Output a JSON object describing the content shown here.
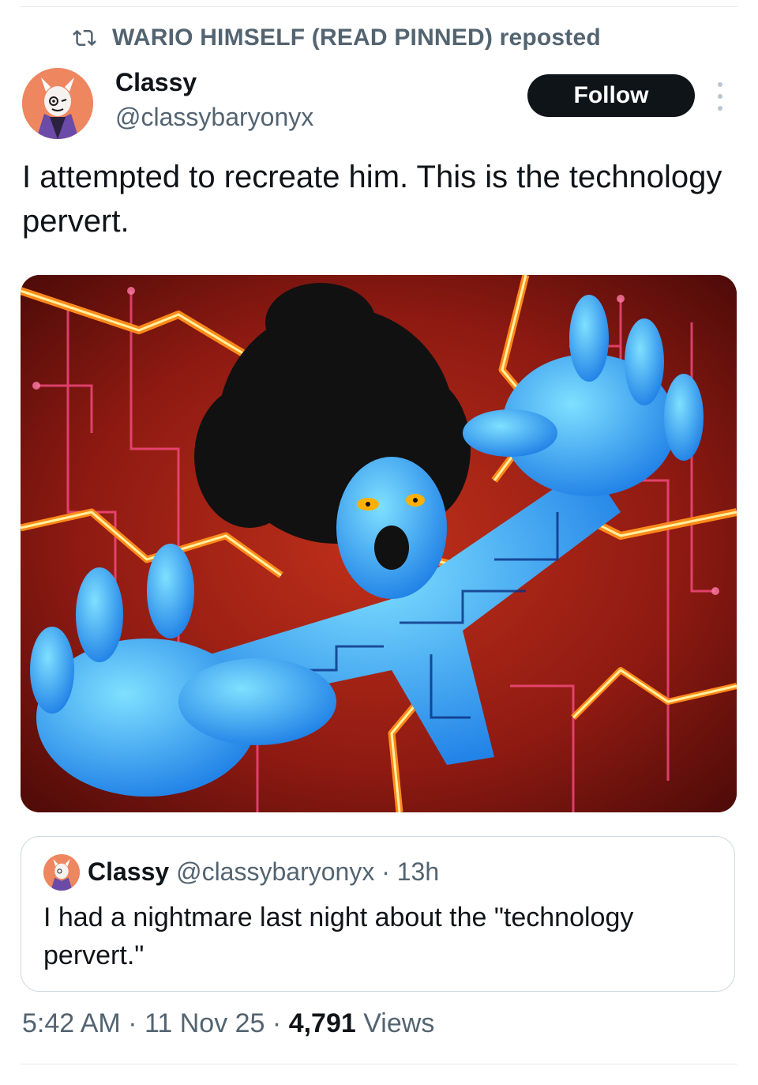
{
  "repost": {
    "label": "WARIO HIMSELF (READ PINNED) reposted",
    "icon": "repost-icon"
  },
  "author": {
    "name": "Classy",
    "handle": "@classybaryonyx",
    "avatar_icon": "avatar"
  },
  "follow_label": "Follow",
  "more_icon": "more-vertical-icon",
  "post": {
    "text": "I attempted to recreate him. This is the technology pervert."
  },
  "media": {
    "alt_icon": "image"
  },
  "quote": {
    "name": "Classy",
    "handle": "@classybaryonyx",
    "separator": "·",
    "time": "13h",
    "text": "I had a nightmare last night about the \"technology pervert.\""
  },
  "meta": {
    "time": "5:42 AM",
    "sep1": "·",
    "date": "11 Nov 25",
    "sep2": "·",
    "views_count": "4,791",
    "views_label": "Views"
  },
  "colors": {
    "text": "#0f1419",
    "secondary": "#536471",
    "follow_bg": "#0f1419",
    "border": "#cfd9de"
  }
}
